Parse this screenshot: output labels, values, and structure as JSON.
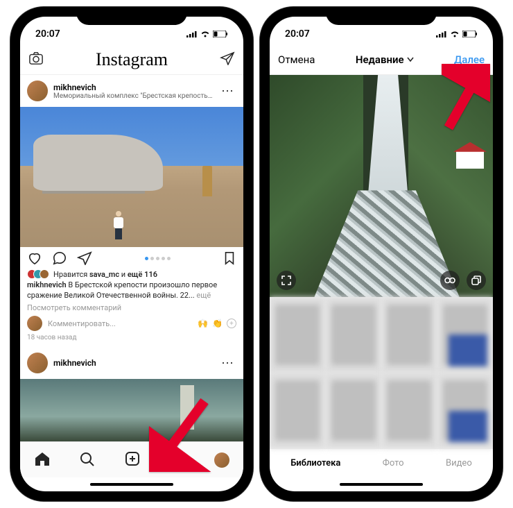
{
  "statusbar": {
    "time": "20:07"
  },
  "feed_screen": {
    "header": {
      "logo_text": "Instagram"
    },
    "post": {
      "username": "mikhnevich",
      "location": "Мемориальный комплекс \"Брестская крепость-ге...",
      "likes_text_prefix": "Нравится ",
      "likes_user": "sava_mc",
      "likes_text_middle": " и ",
      "likes_text_suffix": "ещё 116",
      "caption_user": "mikhnevich",
      "caption_text": " В Брестской крепости произошло первое сражение Великой Отечественной войны. 22... ",
      "caption_more": "ещё",
      "view_comments": "Посмотреть комментарий",
      "comment_placeholder": "Комментировать...",
      "emoji_1": "🙌",
      "emoji_2": "👏",
      "time_ago": "18 часов назад"
    },
    "post2": {
      "username": "mikhnevich"
    }
  },
  "picker_screen": {
    "header": {
      "cancel": "Отмена",
      "title": "Недавние",
      "next": "Далее"
    },
    "tabs": {
      "library": "Библиотека",
      "photo": "Фото",
      "video": "Видео"
    }
  },
  "icons": {
    "camera": "camera",
    "dm": "paper-plane",
    "chevron_down": "chevron-down",
    "expand": "expand",
    "infinity": "infinity",
    "multi": "multi-select"
  }
}
